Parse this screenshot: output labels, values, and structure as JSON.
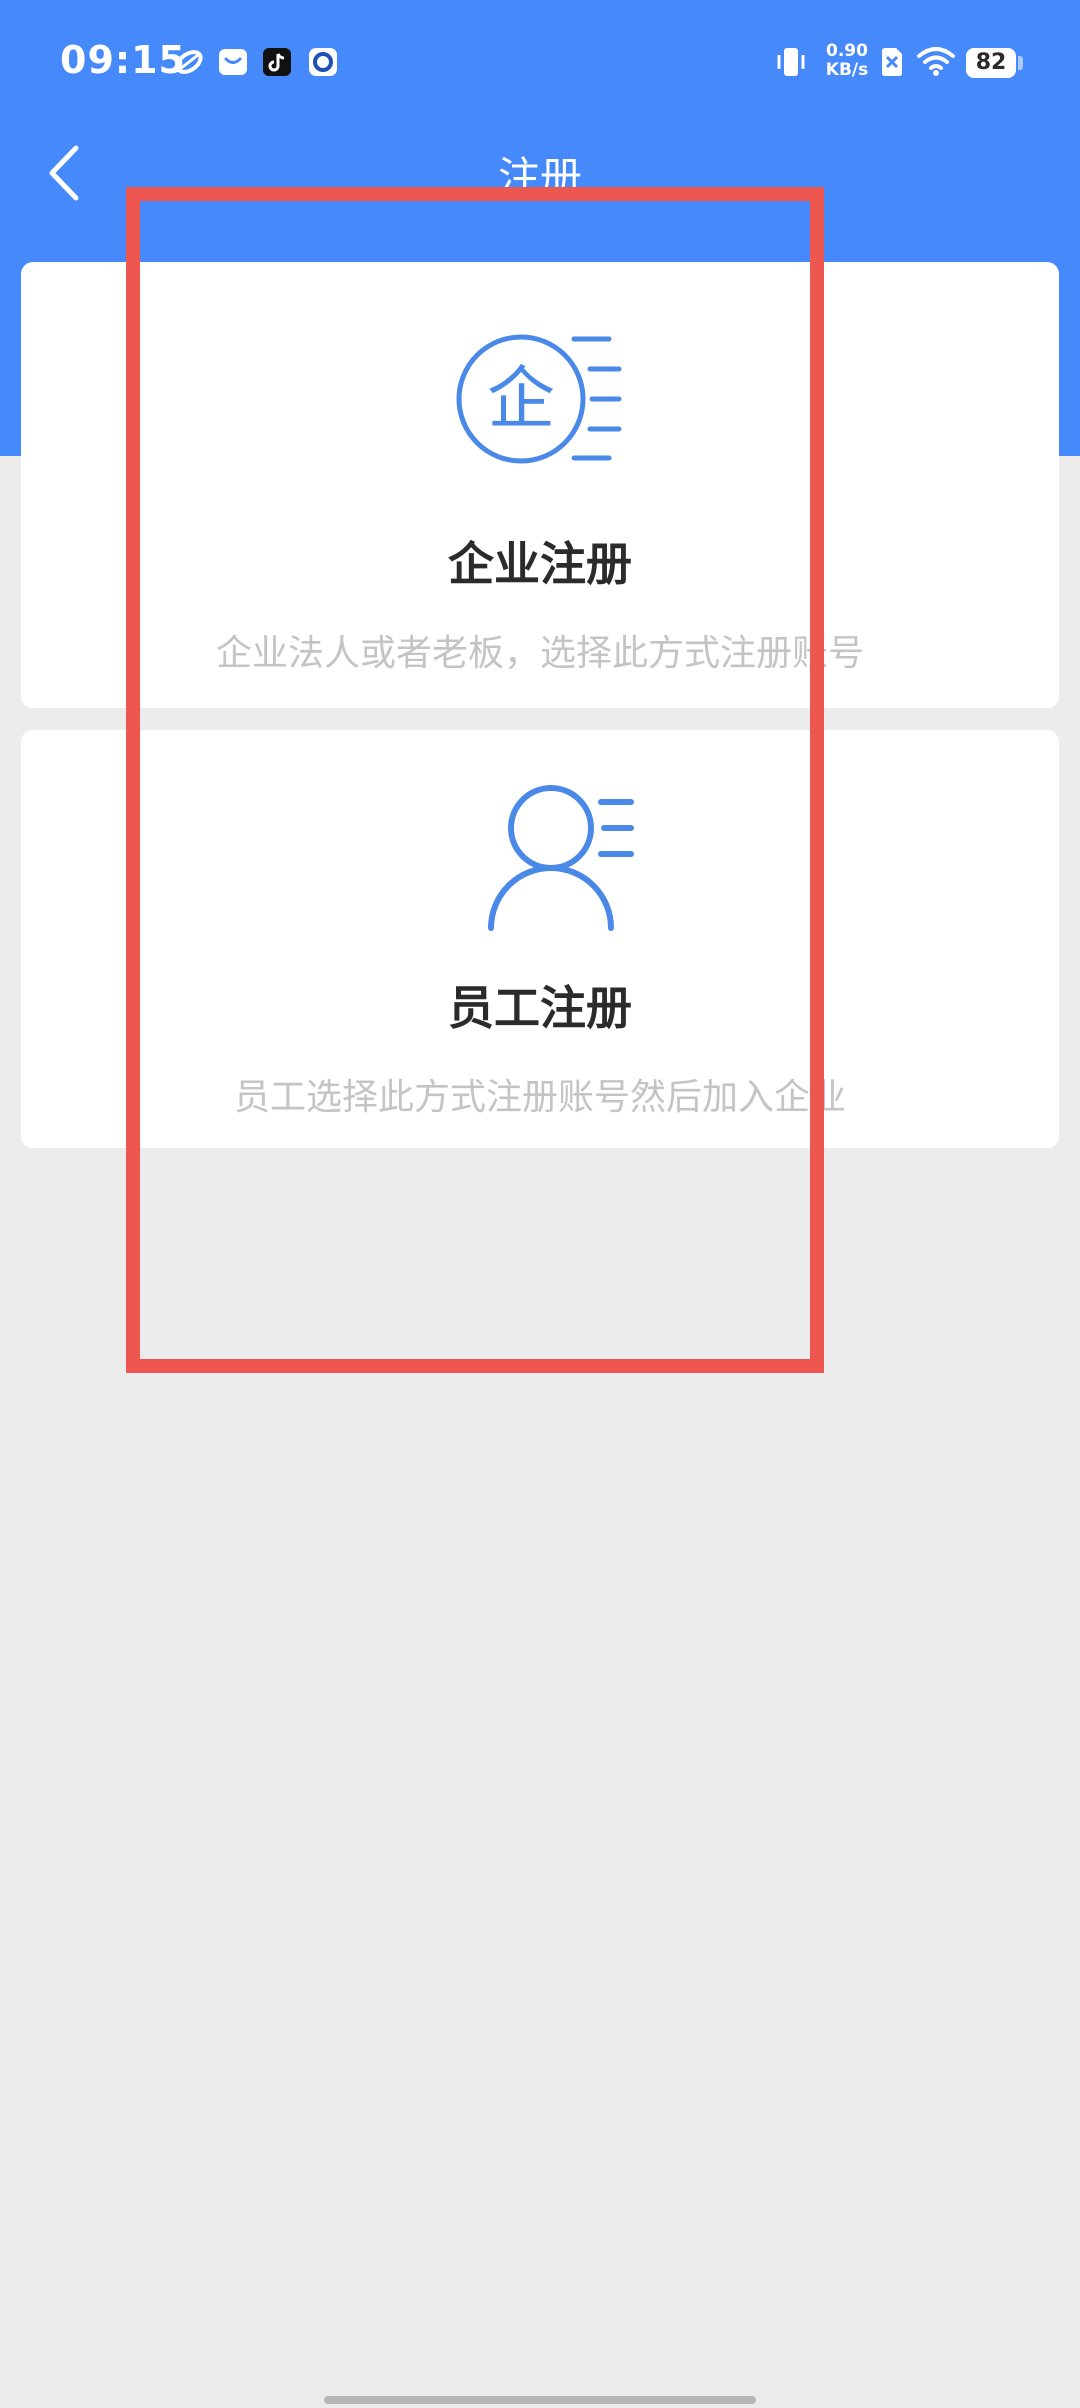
{
  "status_bar": {
    "time": "09:15",
    "net_speed_value": "0.90",
    "net_speed_unit": "KB/s",
    "battery_level": "82",
    "icons": [
      "app-notification-icon",
      "mail-icon",
      "tiktok-icon",
      "browser-icon",
      "vibrate-icon",
      "sim-disabled-icon",
      "wifi-icon",
      "battery-icon"
    ]
  },
  "nav": {
    "title": "注册",
    "back_icon": "chevron-left-icon"
  },
  "options": [
    {
      "title": "企业注册",
      "description": "企业法人或者老板，选择此方式注册账号",
      "icon": "enterprise-icon",
      "icon_glyph": "企"
    },
    {
      "title": "员工注册",
      "description": "员工选择此方式注册账号然后加入企业",
      "icon": "employee-icon"
    }
  ],
  "colors": {
    "brand_blue": "#4589fb",
    "icon_blue": "#4a89e8",
    "highlight_red": "#ee5650",
    "background": "#ececec"
  }
}
